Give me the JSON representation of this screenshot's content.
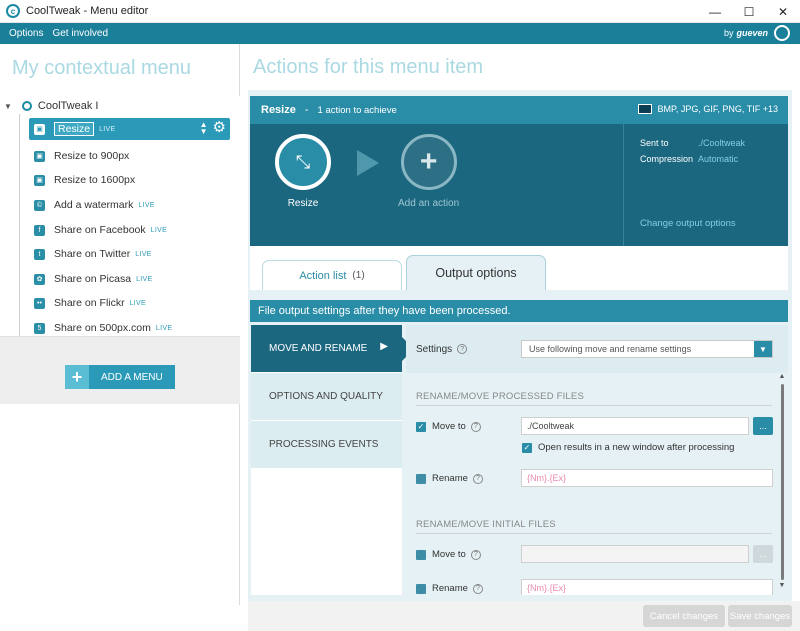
{
  "window": {
    "title": "CoolTweak - Menu editor",
    "minimize": "—",
    "maximize": "☐",
    "close": "✕"
  },
  "menubar": {
    "options": "Options",
    "get_involved": "Get involved",
    "by": "by",
    "brand": "gueven"
  },
  "left": {
    "heading": "My contextual menu",
    "root_label": "CoolTweak I",
    "items": [
      {
        "label": "Resize",
        "live": "LIVE",
        "icon": "image-icon"
      },
      {
        "label": "Resize to 900px",
        "live": "",
        "icon": "image-icon"
      },
      {
        "label": "Resize to 1600px",
        "live": "",
        "icon": "image-icon"
      },
      {
        "label": "Add a watermark",
        "live": "LIVE",
        "icon": "copyright-icon"
      },
      {
        "label": "Share on Facebook",
        "live": "LIVE",
        "icon": "facebook-icon"
      },
      {
        "label": "Share on Twitter",
        "live": "LIVE",
        "icon": "twitter-icon"
      },
      {
        "label": "Share on Picasa",
        "live": "LIVE",
        "icon": "picasa-icon"
      },
      {
        "label": "Share on Flickr",
        "live": "LIVE",
        "icon": "flickr-icon"
      },
      {
        "label": "Share on 500px.com",
        "live": "LIVE",
        "icon": "500px-icon"
      }
    ],
    "add_menu": "ADD A MENU"
  },
  "right": {
    "heading": "Actions for this menu item",
    "header": {
      "action": "Resize",
      "dash": "-",
      "count": "1 action to achieve",
      "formats": "BMP, JPG, GIF, PNG, TIF +13"
    },
    "flow": {
      "step1": "Resize",
      "step2": "Add an action"
    },
    "info": {
      "sent_to_k": "Sent to",
      "sent_to_v": "./Cooltweak",
      "compression_k": "Compression",
      "compression_v": "Automatic",
      "change": "Change output options"
    },
    "tabs": {
      "action_list": "Action list",
      "action_count": "(1)",
      "output_options": "Output options"
    },
    "section": "File output settings after they have been processed.",
    "side_tabs": [
      "MOVE AND RENAME",
      "OPTIONS AND QUALITY",
      "PROCESSING EVENTS"
    ],
    "settings": {
      "label": "Settings",
      "select": "Use following move and rename settings"
    },
    "group1": {
      "title": "RENAME/MOVE PROCESSED FILES",
      "move_to": "Move to",
      "path": "./Cooltweak",
      "browse": "...",
      "open_results": "Open results in a new window after processing",
      "rename": "Rename",
      "pattern": "{Nm}.{Ex}"
    },
    "group2": {
      "title": "RENAME/MOVE INITIAL FILES",
      "move_to": "Move to",
      "browse": "...",
      "rename": "Rename",
      "pattern": "{Nm}.{Ex}"
    }
  },
  "bottom": {
    "cancel": "Cancel changes",
    "save": "Save changes"
  },
  "colors": {
    "accent": "#2a8da8",
    "dark": "#1c6780",
    "heading": "#aad9e2"
  }
}
